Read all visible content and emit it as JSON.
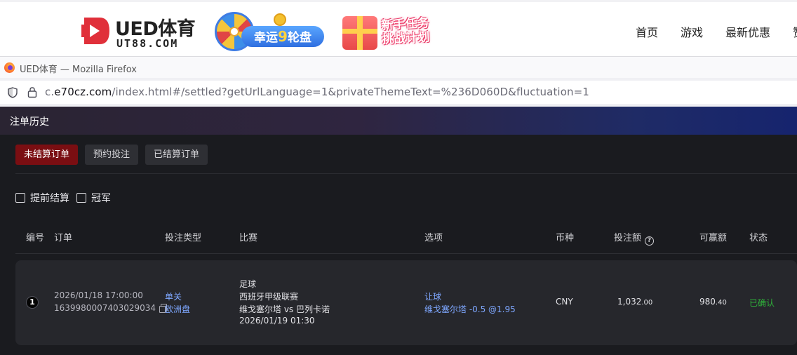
{
  "site": {
    "logo_title": "UED体育",
    "logo_sub": "UT88.COM",
    "wheel_banner": {
      "text_a": "幸运",
      "text_nine": "9",
      "text_b": "轮盘"
    },
    "task_banner": {
      "line1": "新手任务",
      "line2": "挑战计划"
    },
    "nav": [
      "首页",
      "游戏",
      "最新优惠",
      "赞"
    ],
    "colors": {
      "brand_red": "#e0303a",
      "banner_blue": "#2f6fe0"
    }
  },
  "browser": {
    "window_title": "UED体育 — Mozilla Firefox",
    "url_prefix": "c.",
    "url_host": "e70cz.com",
    "url_rest": "/index.html#/settled?getUrlLanguage=1&privateThemeText=%236D060D&fluctuation=1"
  },
  "app": {
    "page_title": "注单历史",
    "tabs": [
      {
        "label": "未结算订单",
        "active": true
      },
      {
        "label": "预约投注",
        "active": false
      },
      {
        "label": "已结算订单",
        "active": false
      }
    ],
    "filters": [
      {
        "label": "提前结算",
        "checked": false
      },
      {
        "label": "冠军",
        "checked": false
      }
    ],
    "columns": {
      "index": "编号",
      "order": "订单",
      "bet_type": "投注类型",
      "match": "比赛",
      "selection": "选项",
      "currency": "币种",
      "stake": "投注额",
      "payout": "可赢额",
      "status": "状态"
    },
    "rows": [
      {
        "index": "1",
        "order_time": "2026/01/18 17:00:00",
        "order_id": "1639980007403029034",
        "bet_type": "单关",
        "odds_type": "欧洲盘",
        "sport": "足球",
        "league": "西班牙甲级联赛",
        "teams": "维戈塞尔塔 vs 巴列卡诺",
        "match_time": "2026/01/19 01:30",
        "market": "让球",
        "pick": "维戈塞尔塔 -0.5 @1.95",
        "currency": "CNY",
        "stake_int": "1,032",
        "stake_dec": ".00",
        "payout_int": "980",
        "payout_dec": ".40",
        "status": "已确认"
      }
    ],
    "colors": {
      "active_tab": "#7a0e12",
      "status_ok": "#2fb23a",
      "link": "#7ea7ff",
      "background": "#1a1b1f"
    }
  }
}
